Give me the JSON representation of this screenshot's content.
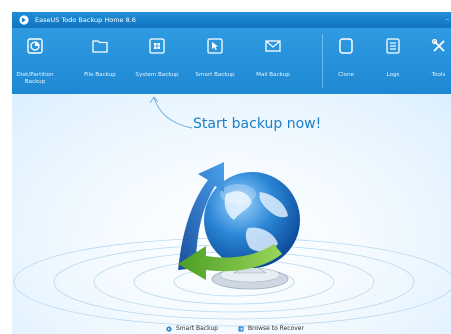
{
  "window": {
    "title": "EaseUS Todo Backup Home 8.6",
    "controls": "–"
  },
  "toolbar": {
    "items": [
      {
        "label": "Disk/Partition\nBackup",
        "icon": "disk-partition-icon"
      },
      {
        "label": "File Backup",
        "icon": "folder-icon"
      },
      {
        "label": "System Backup",
        "icon": "windows-icon"
      },
      {
        "label": "Smart Backup",
        "icon": "cursor-icon"
      },
      {
        "label": "Mail Backup",
        "icon": "mail-icon"
      },
      {
        "label": "Clone",
        "icon": "clone-icon"
      },
      {
        "label": "Logs",
        "icon": "logs-icon"
      },
      {
        "label": "Tools",
        "icon": "tools-icon"
      }
    ]
  },
  "main": {
    "cta_text": "Start backup now!"
  },
  "bottom": {
    "smart_backup": "Smart Backup",
    "browse_recover": "Browse to Recover"
  },
  "colors": {
    "titlebar": "#1273bf",
    "toolbar": "#2f9be2",
    "accent": "#1d7ec7",
    "arrow_blue": "#2a6fc6",
    "arrow_green": "#6bb63a"
  }
}
